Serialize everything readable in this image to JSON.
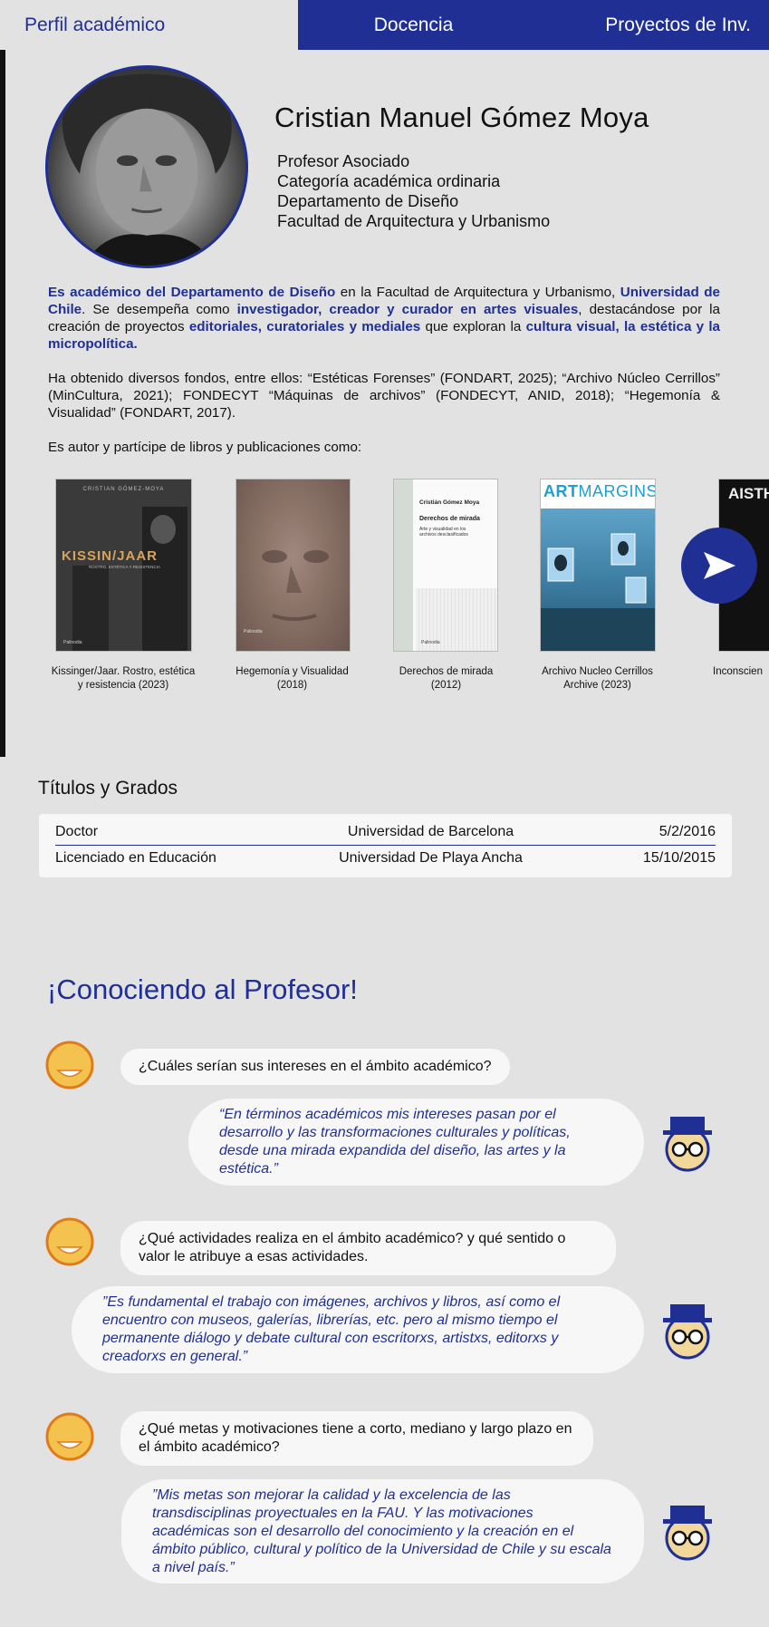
{
  "tabs": {
    "profile": "Perfil académico",
    "teaching": "Docencia",
    "projects": "Proyectos de Inv."
  },
  "profile": {
    "name": "Cristian Manuel Gómez Moya",
    "roles": [
      "Profesor Asociado",
      "Categoría académica ordinaria",
      "Departamento de Diseño",
      "Facultad de Arquitectura y Urbanismo"
    ]
  },
  "bio": {
    "p1": {
      "a": "Es académico del Departamento de Diseño",
      "b": " en la Facultad de Arquitectura y Urbanismo, ",
      "c": "Universidad de Chile",
      "d": ". Se desempeña como ",
      "e": "investigador, creador y curador en artes visuales",
      "f": ", destacándose por la creación de proyectos ",
      "g": "editoriales, curatoriales y mediales",
      "h": " que exploran la ",
      "i": "cultura visual, la estética y la micropolítica."
    },
    "p2": "Ha obtenido diversos fondos, entre ellos: “Estéticas Forenses” (FONDART, 2025); “Archivo Núcleo Cerrillos” (MinCultura, 2021); FONDECYT “Máquinas de archivos” (FONDECYT, ANID, 2018); “Hegemonía & Visualidad” (FONDART, 2017).",
    "p3": "Es autor y partícipe de libros y publicaciones como:"
  },
  "books": [
    {
      "title": "Kissinger/Jaar. Rostro, estética y resistencia (2023)",
      "cover_text": "KISSIN/JAAR",
      "cover_author": "CRISTIAN GÓMEZ-MOYA",
      "cover_sub": "ROSTRO, ESTÉTICA Y RESISTENCIA",
      "publisher": "Palinodia"
    },
    {
      "title": "Hegemonía y Visualidad (2018)",
      "publisher": "Palinodia"
    },
    {
      "title": "Derechos de mirada (2012)",
      "cover_author": "Cristián Gómez Moya",
      "cover_text": "Derechos de mirada",
      "cover_sub": "Arte y visualidad en los archivos desclasificados",
      "publisher": "Palinodia"
    },
    {
      "title": "Archivo Nucleo Cerrillos Archive (2023)",
      "cover_text_a": "ART",
      "cover_text_b": "MARGINS"
    },
    {
      "title": "Inconscien",
      "cover_text": "AISTH"
    }
  ],
  "degrees": {
    "title": "Títulos y Grados",
    "rows": [
      {
        "degree": "Doctor",
        "institution": "Universidad de Barcelona",
        "date": "5/2/2016"
      },
      {
        "degree": "Licenciado en Educación",
        "institution": "Universidad De Playa Ancha",
        "date": "15/10/2015"
      }
    ]
  },
  "conversation": {
    "title": "¡Conociendo al Profesor!",
    "items": [
      {
        "question": "¿Cuáles serían sus intereses en el ámbito académico?",
        "answer": "“En términos académicos mis intereses pasan por el desarrollo y las transformaciones culturales y políticas, desde una mirada expandida del diseño, las artes y la estética.”"
      },
      {
        "question": "¿Qué actividades realiza en el ámbito académico? y qué sentido o valor le atribuye a esas actividades.",
        "answer": "”Es fundamental el trabajo con imágenes, archivos y libros, así como el encuentro con museos, galerías, librerías, etc. pero al mismo tiempo el permanente diálogo y debate cultural con escritorxs, artistxs, editorxs y creadorxs en general.”"
      },
      {
        "question": "¿Qué metas y motivaciones tiene a corto, mediano y largo plazo en el ámbito académico?",
        "answer": "”Mis metas son mejorar la calidad y la excelencia de las transdisciplinas proyectuales en la FAU. Y las motivaciones académicas son el desarrollo del conocimiento y la creación en el ámbito público, cultural y político de la Universidad de Chile y su escala a nivel país.”"
      }
    ]
  },
  "colors": {
    "accent": "#1f2f94",
    "background": "#e2e2e2",
    "bubble": "#f7f7f7",
    "face": "#f4c24f"
  }
}
